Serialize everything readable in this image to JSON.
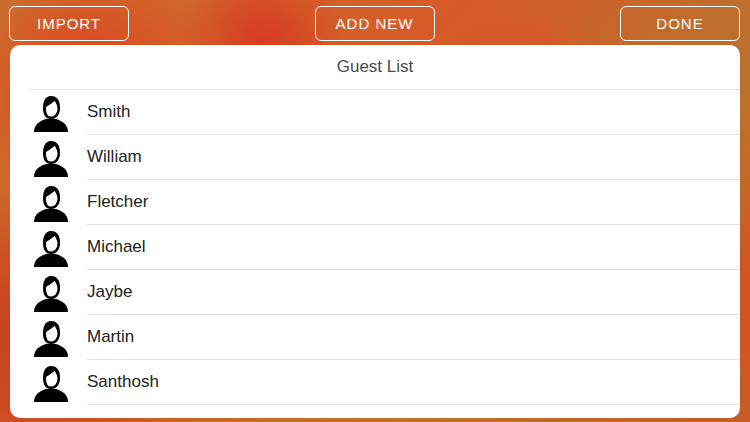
{
  "buttons": {
    "import": "IMPORT",
    "add_new": "ADD NEW",
    "done": "DONE"
  },
  "guest_list": {
    "title": "Guest List",
    "guests": [
      {
        "name": "Smith"
      },
      {
        "name": "William"
      },
      {
        "name": "Fletcher"
      },
      {
        "name": "Michael"
      },
      {
        "name": "Jaybe"
      },
      {
        "name": "Martin"
      },
      {
        "name": "Santhosh"
      }
    ]
  }
}
